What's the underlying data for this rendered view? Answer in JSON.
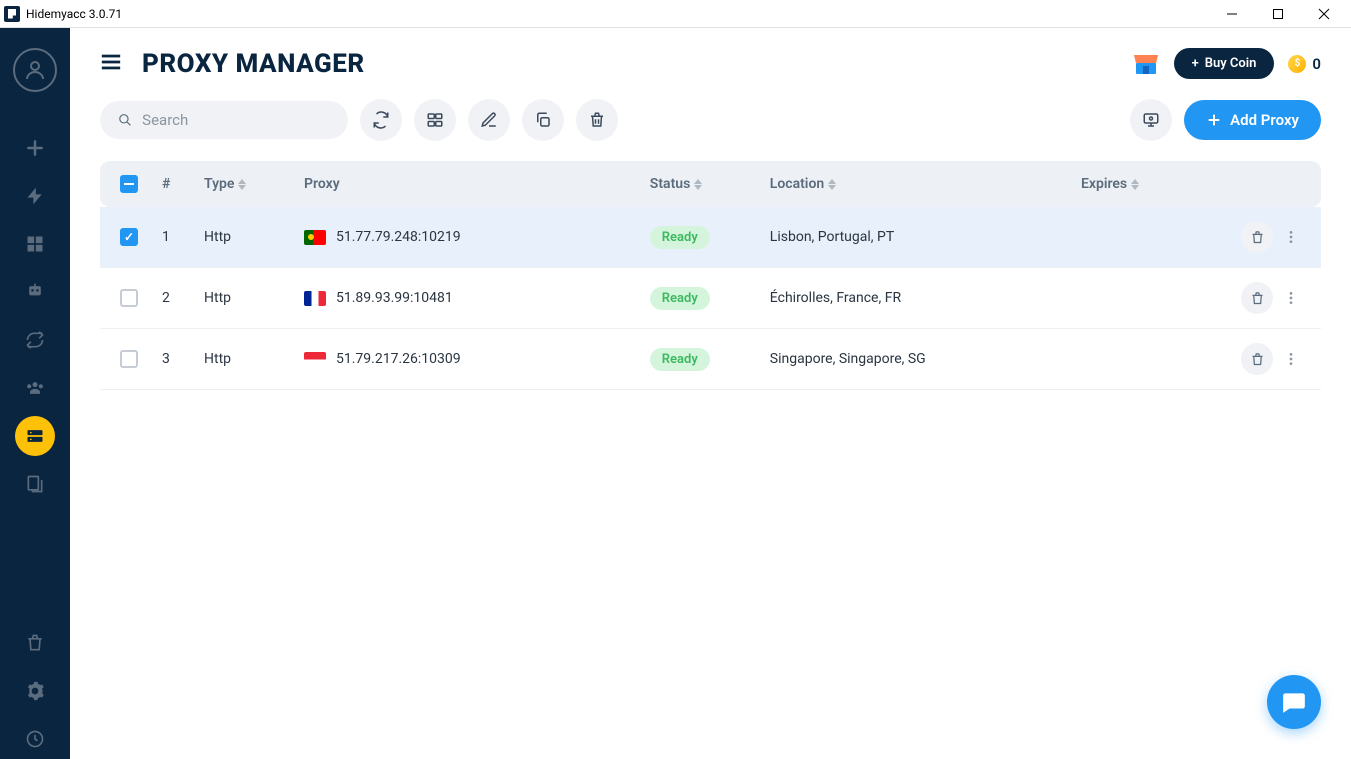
{
  "window": {
    "title": "Hidemyacc 3.0.71"
  },
  "header": {
    "pageTitle": "PROXY MANAGER",
    "buyCoin": "Buy Coin",
    "coinBalance": "0"
  },
  "toolbar": {
    "searchPlaceholder": "Search",
    "addProxy": "Add Proxy"
  },
  "columns": {
    "num": "#",
    "type": "Type",
    "proxy": "Proxy",
    "status": "Status",
    "location": "Location",
    "expires": "Expires"
  },
  "rows": [
    {
      "num": "1",
      "type": "Http",
      "flag": "pt",
      "proxy": "51.77.79.248:10219",
      "status": "Ready",
      "location": "Lisbon, Portugal, PT",
      "expires": "",
      "checked": true
    },
    {
      "num": "2",
      "type": "Http",
      "flag": "fr",
      "proxy": "51.89.93.99:10481",
      "status": "Ready",
      "location": "Échirolles, France, FR",
      "expires": "",
      "checked": false
    },
    {
      "num": "3",
      "type": "Http",
      "flag": "sg",
      "proxy": "51.79.217.26:10309",
      "status": "Ready",
      "location": "Singapore, Singapore, SG",
      "expires": "",
      "checked": false
    }
  ]
}
